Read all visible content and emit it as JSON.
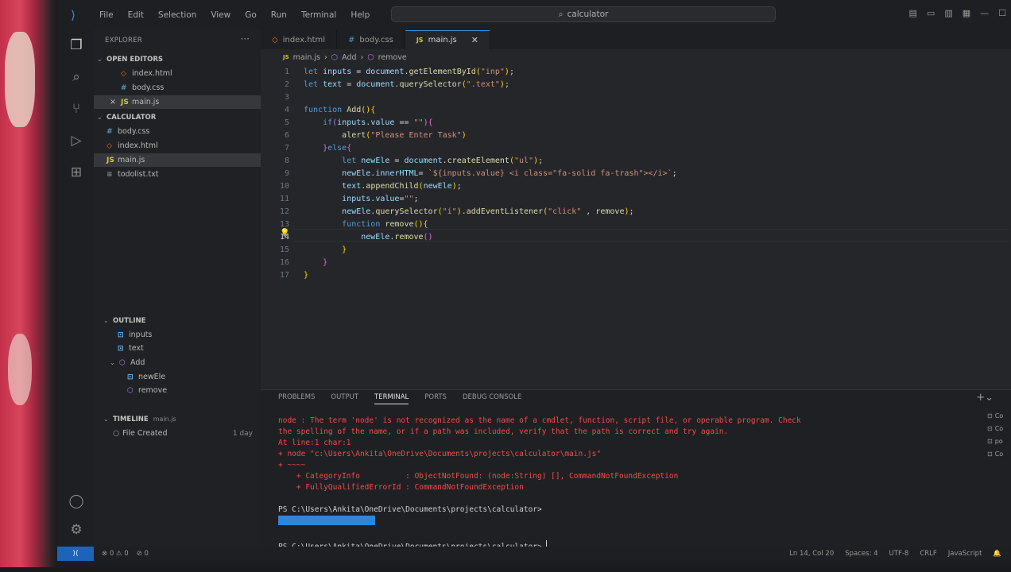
{
  "titlebar": {
    "menu": [
      "File",
      "Edit",
      "Selection",
      "View",
      "Go",
      "Run",
      "Terminal",
      "Help"
    ],
    "search_text": "calculator"
  },
  "sidebar": {
    "explorer_label": "EXPLORER",
    "open_editors_label": "OPEN EDITORS",
    "open_editors": [
      "index.html",
      "body.css",
      "main.js"
    ],
    "project_label": "CALCULATOR",
    "files": [
      "body.css",
      "index.html",
      "main.js",
      "todolist.txt"
    ],
    "outline_label": "OUTLINE",
    "outline": {
      "inputs": "inputs",
      "text": "text",
      "add": "Add",
      "newele": "newEle",
      "remove": "remove"
    },
    "timeline_label": "TIMELINE",
    "timeline_file": "main.js",
    "timeline_entry": "File Created",
    "timeline_time": "1 day"
  },
  "tabs": [
    "index.html",
    "body.css",
    "main.js"
  ],
  "breadcrumb": {
    "file": "main.js",
    "fn": "Add",
    "inner": "remove"
  },
  "editor": {
    "line_numbers": [
      "1",
      "2",
      "3",
      "4",
      "5",
      "6",
      "7",
      "8",
      "9",
      "10",
      "11",
      "12",
      "13",
      "14",
      "15",
      "16",
      "17"
    ],
    "current_line": 14
  },
  "panel": {
    "tabs": [
      "PROBLEMS",
      "OUTPUT",
      "TERMINAL",
      "PORTS",
      "DEBUG CONSOLE"
    ],
    "active_tab": "TERMINAL",
    "lines": {
      "l1": "node : The term 'node' is not recognized as the name of a cmdlet, function, script file, or operable program. Check",
      "l2": "the spelling of the name, or if a path was included, verify that the path is correct and try again.",
      "l3": "At line:1 char:1",
      "l4": "+ node \"c:\\Users\\Ankita\\OneDrive\\Documents\\projects\\calculator\\main.js\"",
      "l5": "+ ~~~~",
      "l6": "    + CategoryInfo          : ObjectNotFound: (node:String) [], CommandNotFoundException",
      "l7": "    + FullyQualifiedErrorId : CommandNotFoundException",
      "l8": "PS C:\\Users\\Ankita\\OneDrive\\Documents\\projects\\calculator>",
      "l9": "PS C:\\Users\\Ankita\\OneDrive\\Documents\\projects\\calculator> "
    },
    "side_list": [
      "Co",
      "Co",
      "po",
      "Co"
    ]
  },
  "statusbar": {
    "problems": "⊗ 0 ⚠ 0",
    "ports": "⊘ 0",
    "position": "Ln 14, Col 20",
    "spaces": "Spaces: 4",
    "encoding": "UTF-8",
    "eol": "CRLF",
    "language": "JavaScript"
  }
}
